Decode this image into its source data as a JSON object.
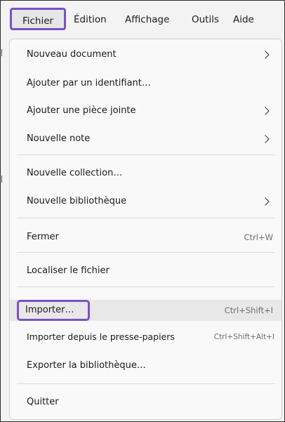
{
  "menubar": {
    "items": [
      {
        "label": "Fichier"
      },
      {
        "label": "Édition"
      },
      {
        "label": "Affichage"
      },
      {
        "label": "Outils"
      },
      {
        "label": "Aide"
      }
    ]
  },
  "menu": {
    "items": [
      {
        "label": "Nouveau document",
        "shortcut": "",
        "has_submenu": true
      },
      {
        "label": "Ajouter par un identifiant…",
        "shortcut": "",
        "has_submenu": false
      },
      {
        "label": "Ajouter une pièce jointe",
        "shortcut": "",
        "has_submenu": true
      },
      {
        "label": "Nouvelle note",
        "shortcut": "",
        "has_submenu": true
      },
      {
        "label": "Nouvelle collection…",
        "shortcut": "",
        "has_submenu": false
      },
      {
        "label": "Nouvelle bibliothèque",
        "shortcut": "",
        "has_submenu": true
      },
      {
        "label": "Fermer",
        "shortcut": "Ctrl+W",
        "has_submenu": false
      },
      {
        "label": "Localiser le fichier",
        "shortcut": "",
        "has_submenu": false
      },
      {
        "label": "Importer…",
        "shortcut": "Ctrl+Shift+I",
        "has_submenu": false
      },
      {
        "label": "Importer depuis le presse-papiers",
        "shortcut": "Ctrl+Shift+Alt+I",
        "has_submenu": false
      },
      {
        "label": "Exporter la bibliothèque…",
        "shortcut": "",
        "has_submenu": false
      },
      {
        "label": "Quitter",
        "shortcut": "",
        "has_submenu": false
      }
    ]
  },
  "colors": {
    "highlight_border": "#7b51c4",
    "menu_background": "#f9f9f9",
    "hover_background": "#e8e8e8"
  }
}
